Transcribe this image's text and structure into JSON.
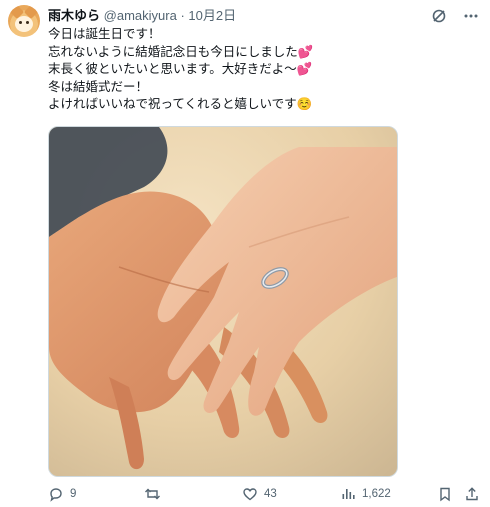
{
  "tweet": {
    "display_name": "雨木ゆら",
    "handle": "@amakiyura",
    "date": "10月2日",
    "lines": [
      "今日は誕生日です！",
      "忘れないように結婚記念日も今日にしました💕",
      "末長く彼といたいと思います。大好きだよ〜💕",
      "冬は結婚式だー！",
      "よければいいねで祝ってくれると嬉しいです☺️"
    ],
    "image_alt": "手を重ねた二人の手と結婚指輪の水彩イラスト"
  },
  "actions": {
    "reply_count": "9",
    "retweet_count": "",
    "like_count": "43",
    "view_count": "1,622"
  },
  "colors": {
    "text": "#0f1419",
    "secondary": "#536471",
    "border": "#cfd9de"
  },
  "icons": [
    "avatar",
    "grok-icon",
    "more-icon",
    "reply-icon",
    "retweet-icon",
    "like-icon",
    "views-icon",
    "bookmark-icon",
    "share-icon"
  ]
}
